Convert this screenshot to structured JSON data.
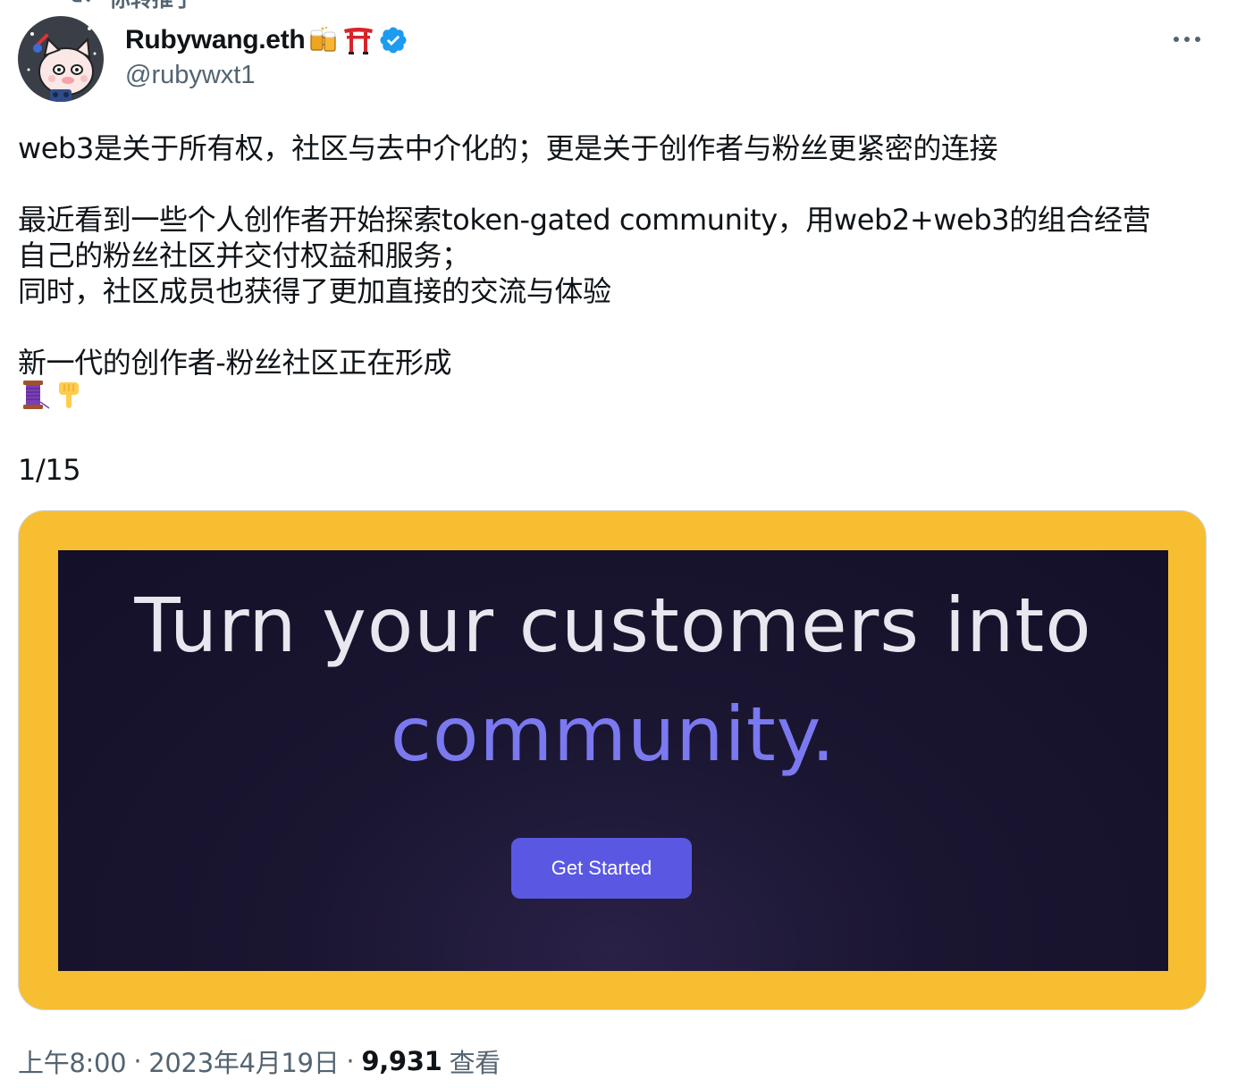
{
  "retweet_context": {
    "label": "你转推了"
  },
  "author": {
    "display_name": "Rubywang.eth",
    "name_emojis": [
      "beer-mugs-emoji",
      "torii-gate-emoji"
    ],
    "verified_badge": "verified-icon",
    "handle": "@rubywxt1",
    "avatar_icon": "cartoon-cat-avatar"
  },
  "more_button": {
    "icon": "more-horizontal-icon"
  },
  "tweet": {
    "lines": [
      "web3是关于所有权，社区与去中介化的；更是关于创作者与粉丝更紧密的连接",
      "",
      "最近看到一些个人创作者开始探索token-gated community，用web2+web3的组合经营",
      "自己的粉丝社区并交付权益和服务；",
      "同时，社区成员也获得了更加直接的交流与体验",
      "",
      "新一代的创作者-粉丝社区正在形成"
    ],
    "emoji_line": [
      "thread-spool-emoji",
      "backhand-index-pointing-down-emoji"
    ],
    "counter": "1/15"
  },
  "media": {
    "headline_line1": "Turn your customers into",
    "headline_line2": "community.",
    "cta_label": "Get Started",
    "colors": {
      "frame": "#f7be31",
      "background": "#141029",
      "accent": "#7b79f0",
      "button": "#5a58e3"
    }
  },
  "meta": {
    "time": "上午8:00",
    "date": "2023年4月19日",
    "separator": "·",
    "views_count": "9,931",
    "views_label": "查看"
  }
}
